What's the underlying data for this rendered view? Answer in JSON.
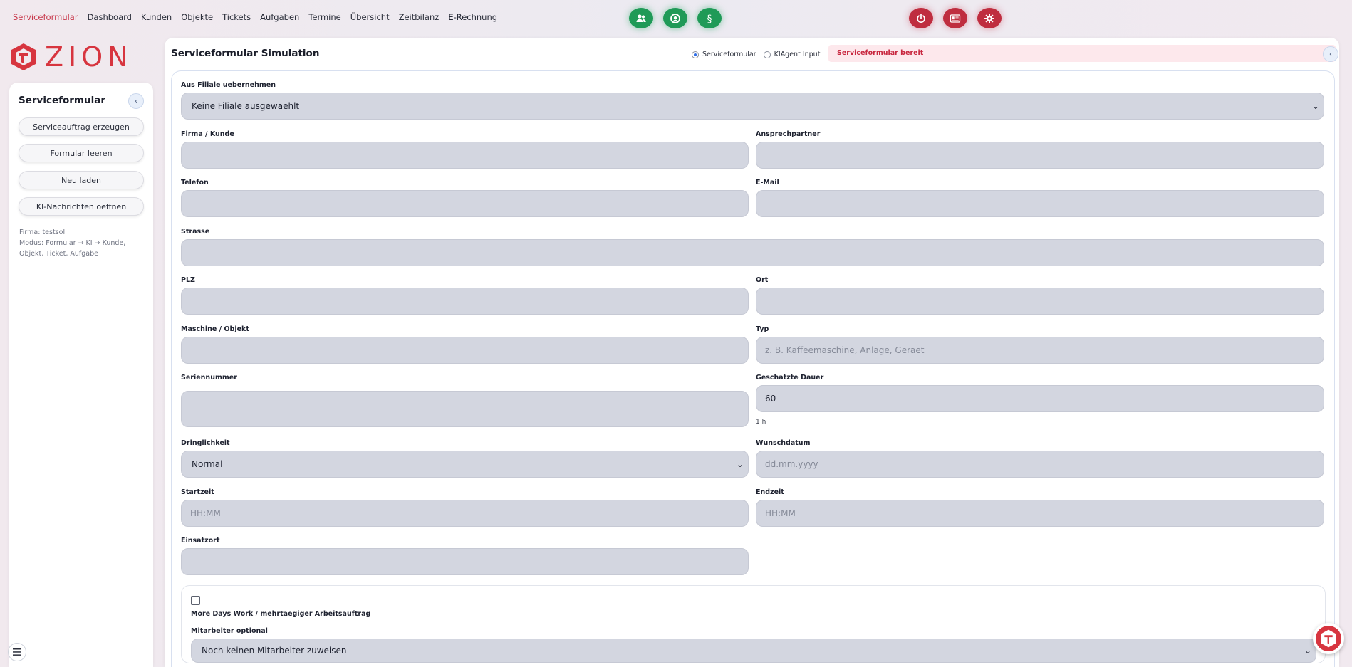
{
  "nav": {
    "items": [
      {
        "label": "Serviceformular",
        "active": true
      },
      {
        "label": "Dashboard"
      },
      {
        "label": "Kunden"
      },
      {
        "label": "Objekte"
      },
      {
        "label": "Tickets"
      },
      {
        "label": "Aufgaben"
      },
      {
        "label": "Termine"
      },
      {
        "label": "Übersicht"
      },
      {
        "label": "Zeitbilanz"
      },
      {
        "label": "E-Rechnung"
      }
    ],
    "action_icons": [
      "users-icon",
      "support-icon",
      "paragraph-icon",
      "power-icon",
      "id-card-icon",
      "gear-icon"
    ]
  },
  "brand": {
    "name": "ZION",
    "color": "#d7353f"
  },
  "sidebar": {
    "title": "Serviceformular",
    "collapse_label": "‹",
    "buttons": [
      "Serviceauftrag erzeugen",
      "Formular leeren",
      "Neu laden",
      "KI-Nachrichten oeffnen"
    ],
    "info_firma": "Firma: testsol",
    "info_modus": "Modus: Formular → KI → Kunde, Objekt, Ticket, Aufgabe"
  },
  "main": {
    "title": "Serviceformular Simulation",
    "collapse_label": "‹",
    "mode_options": [
      {
        "label": "Serviceformular",
        "checked": true
      },
      {
        "label": "KIAgent Input",
        "checked": false
      }
    ],
    "status": "Serviceformular bereit"
  },
  "form": {
    "filiale": {
      "label": "Aus Filiale uebernehmen",
      "value": "Keine Filiale ausgewaehlt"
    },
    "firma": {
      "label": "Firma / Kunde",
      "value": ""
    },
    "ansprechpartner": {
      "label": "Ansprechpartner",
      "value": ""
    },
    "telefon": {
      "label": "Telefon",
      "value": ""
    },
    "email": {
      "label": "E-Mail",
      "value": ""
    },
    "strasse": {
      "label": "Strasse",
      "value": ""
    },
    "plz": {
      "label": "PLZ",
      "value": ""
    },
    "ort": {
      "label": "Ort",
      "value": ""
    },
    "maschine": {
      "label": "Maschine / Objekt",
      "value": ""
    },
    "typ": {
      "label": "Typ",
      "placeholder": "z. B. Kaffeemaschine, Anlage, Geraet"
    },
    "seriennummer": {
      "label": "Seriennummer",
      "value": ""
    },
    "dauer": {
      "label": "Geschatzte Dauer",
      "value": "60",
      "hint": "1 h"
    },
    "dringlichkeit": {
      "label": "Dringlichkeit",
      "value": "Normal"
    },
    "wunschdatum": {
      "label": "Wunschdatum",
      "placeholder": "dd.mm.yyyy"
    },
    "startzeit": {
      "label": "Startzeit",
      "placeholder": "HH:MM"
    },
    "endzeit": {
      "label": "Endzeit",
      "placeholder": "HH:MM"
    },
    "einsatzort": {
      "label": "Einsatzort",
      "value": ""
    },
    "mehrtaegig": {
      "label": "More Days Work / mehrtaegiger Arbeitsauftrag",
      "checked": false
    },
    "mitarbeiter": {
      "label": "Mitarbeiter optional",
      "value": "Noch keinen Mitarbeiter zuweisen"
    }
  }
}
